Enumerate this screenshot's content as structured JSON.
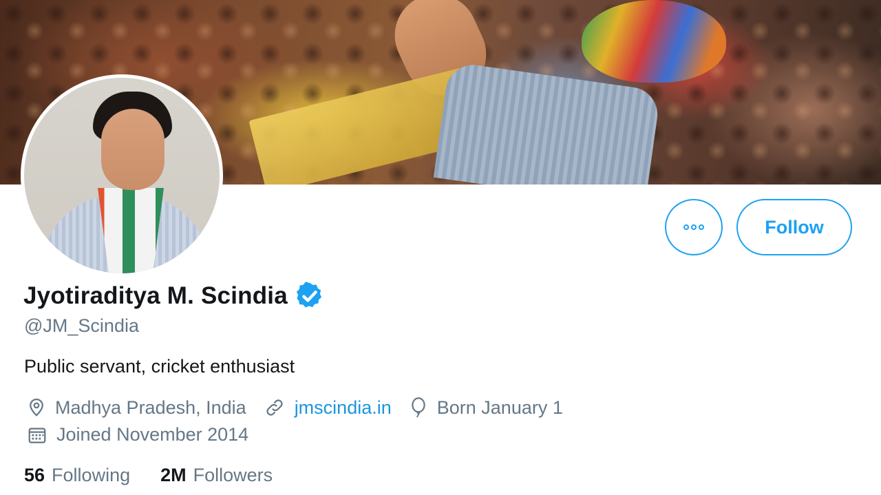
{
  "profile": {
    "name": "Jyotiraditya M. Scindia",
    "handle": "@JM_Scindia",
    "bio": "Public servant, cricket enthusiast",
    "verified": true,
    "location": "Madhya Pradesh, India",
    "website": "jmscindia.in",
    "birthday": "Born January 1",
    "joined": "Joined November 2014"
  },
  "stats": {
    "following_count": "56",
    "following_label": "Following",
    "followers_count": "2M",
    "followers_label": "Followers"
  },
  "actions": {
    "follow_label": "Follow",
    "more_icon": "more-icon"
  },
  "icons": {
    "location": "location-pin-icon",
    "link": "link-icon",
    "birthday": "balloon-icon",
    "joined": "calendar-icon",
    "verified": "verified-badge-icon"
  },
  "colors": {
    "accent": "#1da1f2",
    "link": "#1b95e0",
    "secondary_text": "#657786",
    "primary_text": "#14171a"
  }
}
